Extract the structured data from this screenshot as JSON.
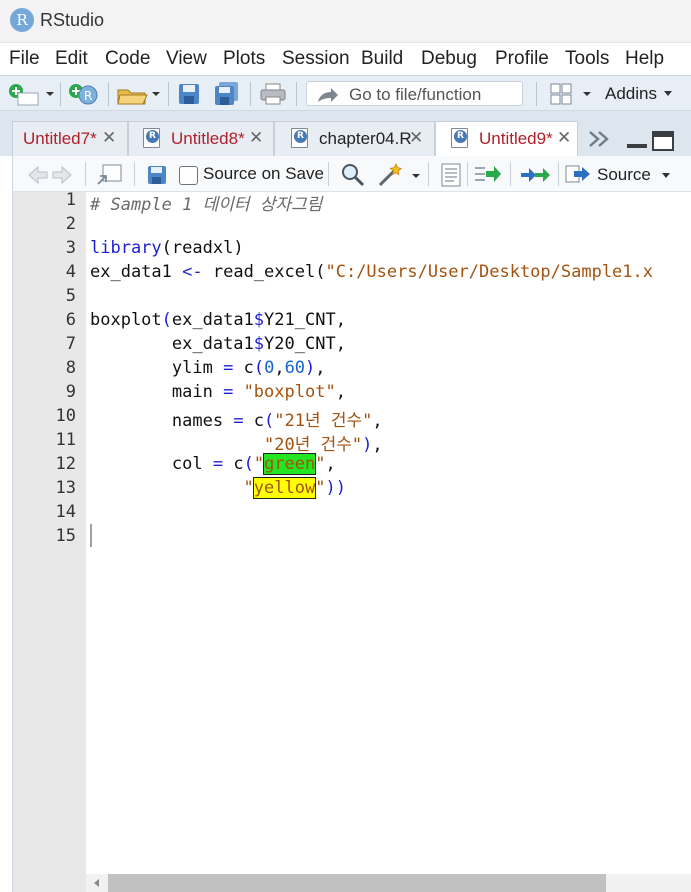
{
  "app": {
    "logo_letter": "R",
    "title": "RStudio"
  },
  "menu": [
    "File",
    "Edit",
    "Code",
    "View",
    "Plots",
    "Session",
    "Build",
    "Debug",
    "Profile",
    "Tools",
    "Help"
  ],
  "toolbar": {
    "goto_placeholder": "Go to file/function",
    "addins_label": "Addins"
  },
  "tabs": [
    {
      "label": "Untitled7*",
      "modified": true,
      "active": false
    },
    {
      "label": "Untitled8*",
      "modified": true,
      "active": false
    },
    {
      "label": "chapter04.R",
      "modified": false,
      "active": false
    },
    {
      "label": "Untitled9*",
      "modified": true,
      "active": true
    }
  ],
  "editor_toolbar": {
    "source_on_save_label": "Source on Save",
    "source_label": "Source"
  },
  "editor": {
    "line_numbers": [
      "1",
      "2",
      "3",
      "4",
      "5",
      "6",
      "7",
      "8",
      "9",
      "10",
      "11",
      "12",
      "13",
      "14",
      "15"
    ],
    "comment": "# Sample 1 데이터 상자그림",
    "library_fn": "library",
    "library_arg": "readxl",
    "var_name": "ex_data1",
    "assign_op": "<-",
    "read_fn": "read_excel",
    "read_path": "\"C:/Users/User/Desktop/Sample1.x",
    "boxplot_fn": "boxplot",
    "col1": "Y21_CNT",
    "col2": "Y20_CNT",
    "ylim_key": "ylim",
    "ylim_a": "0",
    "ylim_b": "60",
    "main_key": "main",
    "main_val": "\"boxplot\"",
    "names_key": "names",
    "name1": "\"21년 건수\"",
    "name2": "\"20년 건수\"",
    "col_key": "col",
    "color1": "green",
    "color2": "yellow"
  },
  "colors": {
    "accent": "#75a8d8",
    "keyword": "#1d1dd4",
    "string": "#a3530f",
    "number": "#1765c9",
    "tab_modified": "#b0202a"
  }
}
